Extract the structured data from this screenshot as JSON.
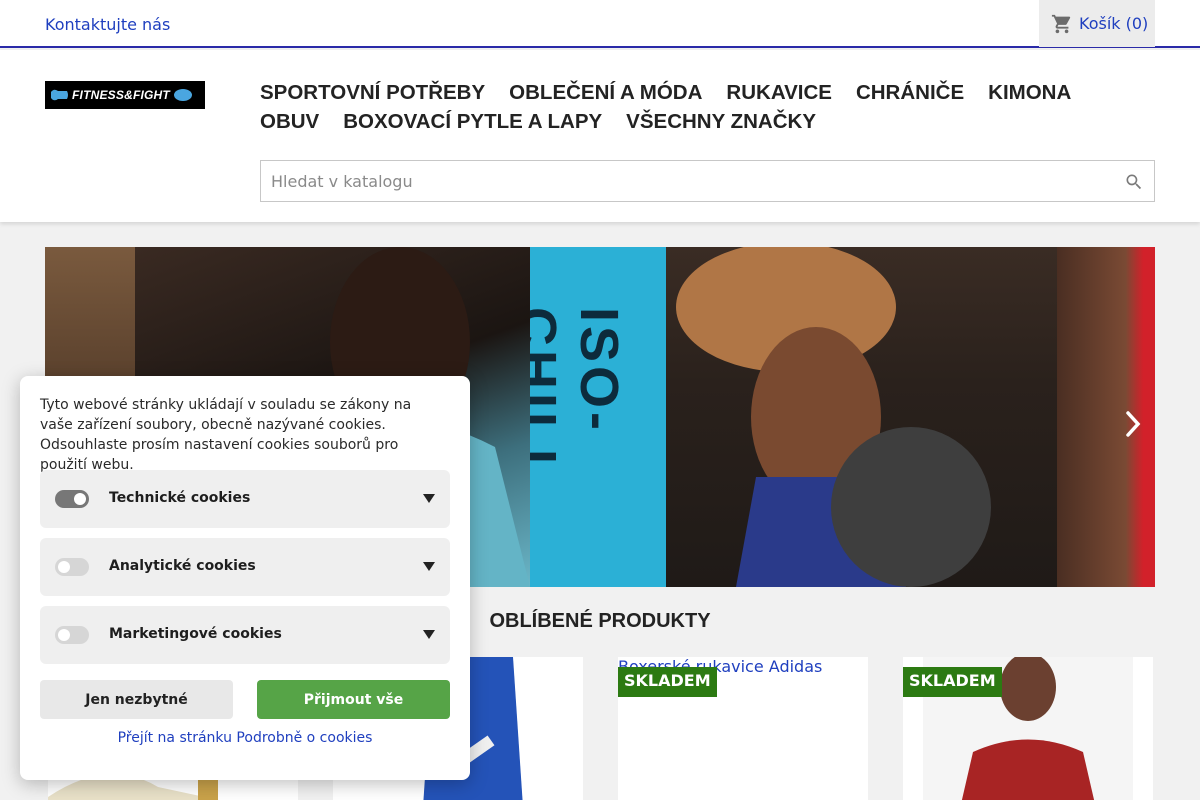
{
  "topbar": {
    "contact_label": "Kontaktujte nás",
    "cart_label": "Košík (0)"
  },
  "header": {
    "logo_text": "FITNESS&FIGHT",
    "nav": [
      "SPORTOVNÍ POTŘEBY",
      "OBLEČENÍ A MÓDA",
      "RUKAVICE",
      "CHRÁNIČE",
      "KIMONA",
      "OBUV",
      "BOXOVACÍ PYTLE A LAPY",
      "VŠECHNY ZNAČKY"
    ],
    "search_placeholder": "Hledat v katalogu"
  },
  "hero": {
    "banner_text": "ISO-CHILL"
  },
  "products": {
    "title": "OBLÍBENÉ PRODUKTY",
    "cards": [
      {
        "badge": "",
        "alt": ""
      },
      {
        "badge": "",
        "alt": ""
      },
      {
        "badge": "SKLADEM",
        "alt": "Boxerské rukavice Adidas černo/zlaté"
      },
      {
        "badge": "SKLADEM",
        "alt": ""
      }
    ]
  },
  "cookies": {
    "text": "Tyto webové stránky ukládají v souladu se zákony na vaše zařízení soubory, obecně nazývané cookies. Odsouhlaste prosím nastavení cookies souborů pro použití webu.",
    "rows": [
      {
        "label": "Technické cookies",
        "enabled": true
      },
      {
        "label": "Analytické cookies",
        "enabled": false
      },
      {
        "label": "Marketingové cookies",
        "enabled": false
      }
    ],
    "necessary_label": "Jen nezbytné",
    "accept_label": "Přijmout vše",
    "details_link": "Přejít na stránku Podrobně o cookies"
  },
  "colors": {
    "link": "#1f3fbf",
    "badge": "#2c7a12",
    "accept": "#56a447",
    "header_border": "#2a2aa8"
  }
}
